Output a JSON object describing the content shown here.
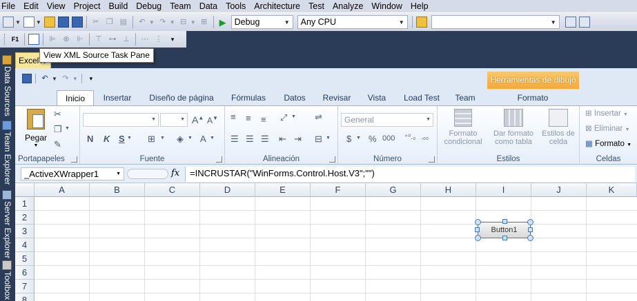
{
  "menu": [
    "File",
    "Edit",
    "View",
    "Project",
    "Build",
    "Debug",
    "Team",
    "Data",
    "Tools",
    "Architecture",
    "Test",
    "Analyze",
    "Window",
    "Help"
  ],
  "toolbar": {
    "config": "Debug",
    "platform": "Any CPU",
    "search_value": ""
  },
  "tooltip": "View XML Source Task Pane",
  "doc_tab": "ExcelW",
  "side_tabs": [
    "Data Sources",
    "Team Explorer",
    "Server Explorer",
    "Toolbox"
  ],
  "ribbon": {
    "contextual_header": "Herramientas de dibujo",
    "tabs": [
      "Inicio",
      "Insertar",
      "Diseño de página",
      "Fórmulas",
      "Datos",
      "Revisar",
      "Vista",
      "Load Test",
      "Team",
      "Formato"
    ],
    "active_tab": "Inicio",
    "groups": {
      "clipboard": {
        "label": "Portapapeles",
        "paste": "Pegar"
      },
      "font": {
        "label": "Fuente",
        "bold": "N",
        "italic": "K",
        "underline": "S"
      },
      "alignment": {
        "label": "Alineación"
      },
      "number": {
        "label": "Número",
        "format_value": "General",
        "currency": "$",
        "percent": "%",
        "thousands": "000"
      },
      "styles": {
        "label": "Estilos",
        "conditional": "Formato condicional",
        "as_table": "Dar formato como tabla",
        "cell_styles": "Estilos de celda"
      },
      "cells": {
        "label": "Celdas",
        "insert": "Insertar",
        "delete": "Eliminar",
        "format": "Formato"
      }
    }
  },
  "formula_bar": {
    "name_box": "_ActiveXWrapper1",
    "fx": "fx",
    "formula": "=INCRUSTAR(\"WinForms.Control.Host.V3\";\"\")"
  },
  "sheet": {
    "columns": [
      "A",
      "B",
      "C",
      "D",
      "E",
      "F",
      "G",
      "H",
      "I",
      "J",
      "K"
    ],
    "rows": [
      "1",
      "2",
      "3",
      "4",
      "5",
      "6",
      "7",
      "8"
    ]
  },
  "embedded_button": "Button1"
}
